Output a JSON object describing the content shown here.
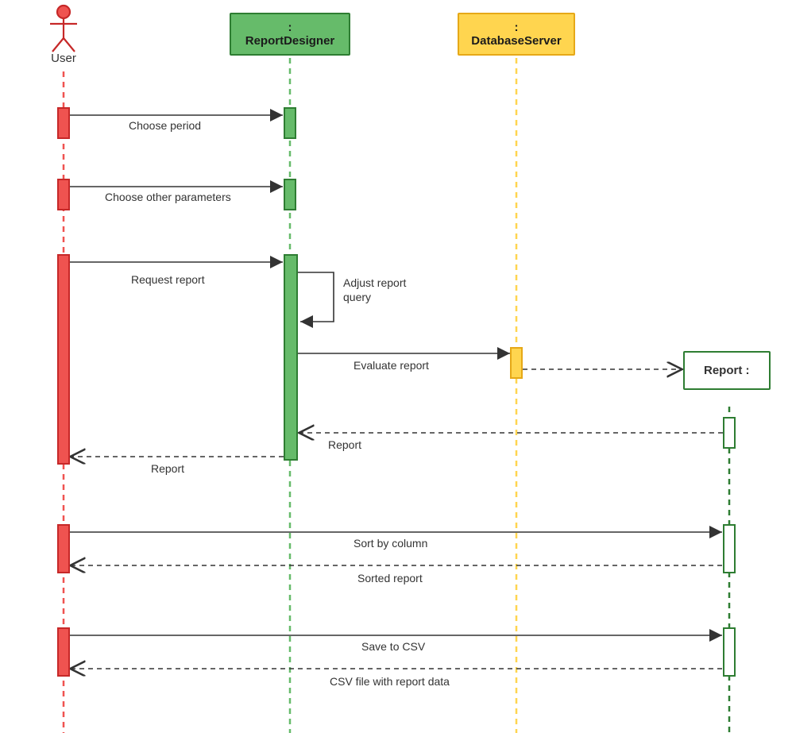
{
  "colors": {
    "user": "#ef5350",
    "user_border": "#c62828",
    "designer": "#66bb6a",
    "designer_border": "#2e7d32",
    "db": "#ffd54f",
    "db_border": "#e6a817",
    "report_border": "#2e7d32"
  },
  "participants": {
    "user": {
      "label": "User"
    },
    "report_designer": {
      "label": ": ReportDesigner"
    },
    "database_server": {
      "label": ": DatabaseServer"
    },
    "report": {
      "label": "Report :"
    }
  },
  "messages": {
    "m1": "Choose period",
    "m2": "Choose other parameters",
    "m3": "Request report",
    "m4": "Adjust report query",
    "m5": "Evaluate report",
    "m6": "Report",
    "m7": "Report",
    "m8": "Sort by column",
    "m9": "Sorted report",
    "m10": "Save to CSV",
    "m11": "CSV file with report data"
  },
  "chart_data": {
    "type": "sequence_diagram",
    "participants": [
      {
        "id": "user",
        "label": "User",
        "kind": "actor"
      },
      {
        "id": "report_designer",
        "label": ": ReportDesigner",
        "kind": "object"
      },
      {
        "id": "database_server",
        "label": ": DatabaseServer",
        "kind": "object"
      },
      {
        "id": "report",
        "label": "Report :",
        "kind": "object",
        "created_by": "database_server"
      }
    ],
    "messages": [
      {
        "from": "user",
        "to": "report_designer",
        "label": "Choose period",
        "type": "sync"
      },
      {
        "from": "user",
        "to": "report_designer",
        "label": "Choose other parameters",
        "type": "sync"
      },
      {
        "from": "user",
        "to": "report_designer",
        "label": "Request report",
        "type": "sync"
      },
      {
        "from": "report_designer",
        "to": "report_designer",
        "label": "Adjust report query",
        "type": "self"
      },
      {
        "from": "report_designer",
        "to": "database_server",
        "label": "Evaluate report",
        "type": "sync"
      },
      {
        "from": "database_server",
        "to": "report",
        "label": "",
        "type": "create"
      },
      {
        "from": "report",
        "to": "report_designer",
        "label": "Report",
        "type": "return"
      },
      {
        "from": "report_designer",
        "to": "user",
        "label": "Report",
        "type": "return"
      },
      {
        "from": "user",
        "to": "report",
        "label": "Sort by column",
        "type": "sync"
      },
      {
        "from": "report",
        "to": "user",
        "label": "Sorted report",
        "type": "return"
      },
      {
        "from": "user",
        "to": "report",
        "label": "Save to CSV",
        "type": "sync"
      },
      {
        "from": "report",
        "to": "user",
        "label": "CSV file with report data",
        "type": "return"
      }
    ]
  }
}
